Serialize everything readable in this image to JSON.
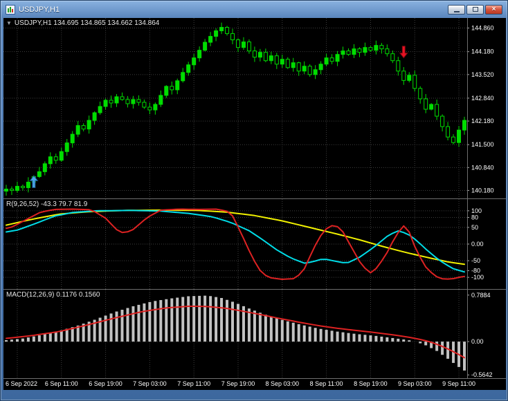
{
  "window": {
    "title": "USDJPY,H1",
    "controls": {
      "minimize": "minimize",
      "maximize": "maximize",
      "close": "×"
    }
  },
  "colors": {
    "background": "#000000",
    "grid": "#3f3f3f",
    "candle": "#00dd00",
    "axis_text": "#ffffff",
    "separator": "#6f6f6f"
  },
  "main_chart": {
    "shift_marker": "▼",
    "label": "USDJPY,H1 134.695 134.865 134.662 134.864",
    "price_labels": [
      "144.860",
      "144.180",
      "143.520",
      "142.840",
      "142.180",
      "141.500",
      "140.840",
      "140.180"
    ]
  },
  "oscillator": {
    "label": "R(9,26,52) -43.3 79.7 81.9",
    "axis_labels": [
      "100",
      "80",
      "50",
      "0.00",
      "-50",
      "-80",
      "-100"
    ]
  },
  "macd_panel": {
    "label": "MACD(12,26,9) 0.1176 0.1560",
    "axis_labels": [
      "0.7884",
      "0.00",
      "-0.5642"
    ]
  },
  "time_axis": {
    "labels": [
      "6 Sep 2022",
      "6 Sep 11:00",
      "6 Sep 19:00",
      "7 Sep 03:00",
      "7 Sep 11:00",
      "7 Sep 19:00",
      "8 Sep 03:00",
      "8 Sep 11:00",
      "8 Sep 19:00",
      "9 Sep 03:00",
      "9 Sep 11:00"
    ],
    "indices": [
      2,
      10,
      18,
      26,
      34,
      42,
      50,
      58,
      66,
      74,
      82
    ]
  },
  "chart_data": [
    {
      "type": "candlestick",
      "title": "USDJPY,H1",
      "x_unit": "1 hour per candle",
      "y_range": [
        139.95,
        145.15
      ],
      "closes": [
        140.22,
        140.18,
        140.3,
        140.26,
        140.42,
        140.58,
        140.72,
        140.95,
        141.15,
        141.05,
        141.3,
        141.55,
        141.8,
        142.05,
        141.95,
        142.2,
        142.42,
        142.6,
        142.78,
        142.7,
        142.88,
        142.8,
        142.68,
        142.8,
        142.72,
        142.58,
        142.5,
        142.66,
        142.92,
        143.18,
        143.08,
        143.34,
        143.58,
        143.8,
        144.0,
        144.22,
        144.45,
        144.62,
        144.78,
        144.88,
        144.7,
        144.52,
        144.3,
        144.46,
        144.2,
        144.02,
        144.16,
        143.92,
        144.06,
        143.82,
        143.96,
        143.72,
        143.86,
        143.62,
        143.76,
        143.52,
        143.66,
        143.82,
        144.0,
        143.9,
        144.1,
        144.2,
        144.1,
        144.26,
        144.16,
        144.3,
        144.22,
        144.36,
        144.26,
        144.12,
        143.92,
        143.62,
        143.35,
        143.5,
        143.12,
        142.82,
        142.52,
        142.66,
        142.32,
        142.02,
        141.72,
        141.56,
        141.92,
        142.2
      ],
      "annotations": [
        {
          "name": "buy-arrow",
          "index": 5,
          "price": 140.6,
          "direction": "up",
          "fill": "#4da6e8",
          "edge": "#1d5e93"
        },
        {
          "name": "sell-arrow",
          "index": 72,
          "price": 144.0,
          "direction": "down",
          "fill": "#e81123",
          "edge": "#7a0a10"
        }
      ]
    },
    {
      "type": "line",
      "title": "R(9,26,52)",
      "values": [
        -43.3,
        79.7,
        81.9
      ],
      "y_range": [
        -135,
        135
      ],
      "levels": [
        100,
        80,
        50,
        0,
        -50,
        -80,
        -100
      ],
      "series": [
        {
          "name": "short",
          "color": "#dd2222",
          "points": [
            [
              0,
              45
            ],
            [
              0.02,
              52
            ],
            [
              0.05,
              74
            ],
            [
              0.08,
              96
            ],
            [
              0.11,
              104
            ],
            [
              0.15,
              105
            ],
            [
              0.19,
              103
            ],
            [
              0.22,
              78
            ],
            [
              0.245,
              42
            ],
            [
              0.26,
              32
            ],
            [
              0.28,
              44
            ],
            [
              0.31,
              80
            ],
            [
              0.34,
              102
            ],
            [
              0.38,
              105
            ],
            [
              0.42,
              104
            ],
            [
              0.46,
              105
            ],
            [
              0.49,
              96
            ],
            [
              0.51,
              40
            ],
            [
              0.53,
              -20
            ],
            [
              0.55,
              -75
            ],
            [
              0.57,
              -100
            ],
            [
              0.6,
              -106
            ],
            [
              0.625,
              -104
            ],
            [
              0.645,
              -86
            ],
            [
              0.66,
              -40
            ],
            [
              0.68,
              18
            ],
            [
              0.7,
              52
            ],
            [
              0.715,
              58
            ],
            [
              0.73,
              42
            ],
            [
              0.75,
              -8
            ],
            [
              0.77,
              -58
            ],
            [
              0.79,
              -88
            ],
            [
              0.805,
              -72
            ],
            [
              0.825,
              -32
            ],
            [
              0.845,
              22
            ],
            [
              0.862,
              56
            ],
            [
              0.875,
              36
            ],
            [
              0.89,
              -18
            ],
            [
              0.91,
              -68
            ],
            [
              0.93,
              -96
            ],
            [
              0.95,
              -106
            ],
            [
              0.97,
              -104
            ],
            [
              0.985,
              -99
            ],
            [
              1,
              -96
            ]
          ]
        },
        {
          "name": "mid",
          "color": "#00dde8",
          "points": [
            [
              0,
              35
            ],
            [
              0.03,
              42
            ],
            [
              0.07,
              62
            ],
            [
              0.11,
              84
            ],
            [
              0.15,
              95
            ],
            [
              0.2,
              100
            ],
            [
              0.28,
              101
            ],
            [
              0.34,
              99
            ],
            [
              0.4,
              92
            ],
            [
              0.45,
              82
            ],
            [
              0.49,
              65
            ],
            [
              0.53,
              40
            ],
            [
              0.56,
              12
            ],
            [
              0.59,
              -18
            ],
            [
              0.62,
              -42
            ],
            [
              0.65,
              -58
            ],
            [
              0.67,
              -52
            ],
            [
              0.69,
              -44
            ],
            [
              0.71,
              -50
            ],
            [
              0.74,
              -58
            ],
            [
              0.77,
              -38
            ],
            [
              0.8,
              -8
            ],
            [
              0.83,
              26
            ],
            [
              0.85,
              40
            ],
            [
              0.87,
              32
            ],
            [
              0.89,
              12
            ],
            [
              0.91,
              -14
            ],
            [
              0.93,
              -38
            ],
            [
              0.95,
              -58
            ],
            [
              0.97,
              -74
            ],
            [
              1,
              -86
            ]
          ]
        },
        {
          "name": "long",
          "color": "#f2f200",
          "points": [
            [
              0,
              55
            ],
            [
              0.06,
              74
            ],
            [
              0.12,
              90
            ],
            [
              0.18,
              97
            ],
            [
              0.26,
              101
            ],
            [
              0.34,
              102
            ],
            [
              0.42,
              101
            ],
            [
              0.48,
              96
            ],
            [
              0.54,
              86
            ],
            [
              0.6,
              70
            ],
            [
              0.66,
              50
            ],
            [
              0.72,
              30
            ],
            [
              0.77,
              12
            ],
            [
              0.82,
              -8
            ],
            [
              0.87,
              -26
            ],
            [
              0.92,
              -42
            ],
            [
              0.96,
              -54
            ],
            [
              1,
              -62
            ]
          ]
        }
      ]
    },
    {
      "type": "macd",
      "title": "MACD(12,26,9)",
      "values": [
        0.1176,
        0.156
      ],
      "y_range": [
        -0.62,
        0.88
      ],
      "histogram_color": "#c2c2c2",
      "signal_color": "#dd2222",
      "histogram": [
        [
          0,
          0.02
        ],
        [
          0.04,
          0.05
        ],
        [
          0.08,
          0.11
        ],
        [
          0.12,
          0.18
        ],
        [
          0.16,
          0.27
        ],
        [
          0.2,
          0.38
        ],
        [
          0.24,
          0.5
        ],
        [
          0.28,
          0.6
        ],
        [
          0.32,
          0.68
        ],
        [
          0.36,
          0.73
        ],
        [
          0.4,
          0.77
        ],
        [
          0.44,
          0.78
        ],
        [
          0.47,
          0.74
        ],
        [
          0.5,
          0.66
        ],
        [
          0.53,
          0.56
        ],
        [
          0.56,
          0.47
        ],
        [
          0.6,
          0.37
        ],
        [
          0.64,
          0.29
        ],
        [
          0.68,
          0.22
        ],
        [
          0.72,
          0.17
        ],
        [
          0.76,
          0.13
        ],
        [
          0.8,
          0.1
        ],
        [
          0.83,
          0.07
        ],
        [
          0.86,
          0.04
        ],
        [
          0.885,
          0.01
        ],
        [
          0.91,
          -0.06
        ],
        [
          0.935,
          -0.16
        ],
        [
          0.96,
          -0.3
        ],
        [
          0.98,
          -0.42
        ],
        [
          1,
          -0.52
        ]
      ],
      "signal": [
        [
          0,
          0.05
        ],
        [
          0.06,
          0.1
        ],
        [
          0.12,
          0.17
        ],
        [
          0.18,
          0.28
        ],
        [
          0.24,
          0.4
        ],
        [
          0.3,
          0.51
        ],
        [
          0.35,
          0.57
        ],
        [
          0.4,
          0.6
        ],
        [
          0.44,
          0.595
        ],
        [
          0.48,
          0.565
        ],
        [
          0.52,
          0.51
        ],
        [
          0.56,
          0.45
        ],
        [
          0.6,
          0.385
        ],
        [
          0.64,
          0.325
        ],
        [
          0.68,
          0.27
        ],
        [
          0.72,
          0.225
        ],
        [
          0.76,
          0.19
        ],
        [
          0.8,
          0.155
        ],
        [
          0.84,
          0.115
        ],
        [
          0.87,
          0.08
        ],
        [
          0.9,
          0.035
        ],
        [
          0.92,
          -0.005
        ],
        [
          0.94,
          -0.06
        ],
        [
          0.96,
          -0.13
        ],
        [
          0.98,
          -0.21
        ],
        [
          1,
          -0.3
        ]
      ]
    }
  ]
}
